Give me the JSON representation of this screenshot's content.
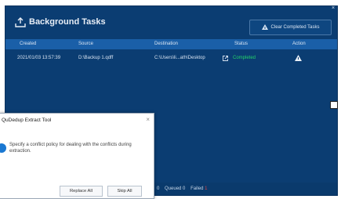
{
  "main_window": {
    "title": "Background Tasks",
    "clear_button_label": "Clear Completed Tasks",
    "columns": [
      "Created",
      "Source",
      "Destination",
      "Status",
      "Action"
    ],
    "tasks": [
      {
        "created": "2021/01/03 13:57:39",
        "source": "D:\\Backup 1.qdff",
        "destination": "C:\\Users\\li...ath\\Desktop",
        "status": "Completed"
      }
    ],
    "footer": {
      "queued_label": "Queued",
      "queued_count": "0",
      "failed_label": "Failed",
      "failed_count": "1",
      "partial_count": "0"
    }
  },
  "dialog": {
    "title": "QuDedup Extract Tool",
    "message": "Specify a conflict policy for dealing with the conflicts during extraction.",
    "replace_all_label": "Replace All",
    "skip_all_label": "Skip All",
    "close_glyph": "×"
  },
  "colors": {
    "window_bg": "#0b3d72",
    "header_row_bg": "#1a5fa8",
    "completed": "#25d36a",
    "failed": "#e14141",
    "info_icon": "#1a78d2"
  },
  "icons": {
    "title": "upload-tray-icon",
    "clear": "clear-tasks-icon",
    "external": "open-external-icon",
    "action": "clear-row-icon",
    "dialog": "info-icon"
  }
}
